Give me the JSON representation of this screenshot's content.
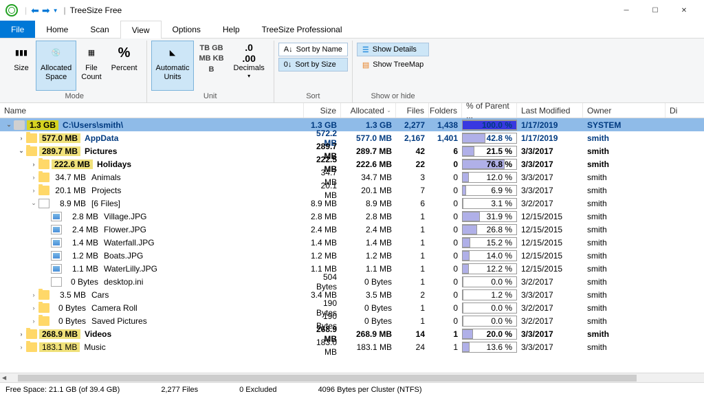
{
  "title": "TreeSize Free",
  "menus": {
    "file": "File",
    "home": "Home",
    "scan": "Scan",
    "view": "View",
    "options": "Options",
    "help": "Help",
    "pro": "TreeSize Professional"
  },
  "ribbon": {
    "mode": {
      "label": "Mode",
      "size": "Size",
      "allocated": "Allocated\nSpace",
      "filecount": "File\nCount",
      "percent": "Percent"
    },
    "unit": {
      "label": "Unit",
      "auto": "Automatic\nUnits",
      "decimals": "Decimals",
      "tb": "TB",
      "gb": "GB",
      "mb": "MB",
      "kb": "KB",
      "b": "B"
    },
    "sort": {
      "label": "Sort",
      "byname": "Sort by Name",
      "bysize": "Sort by Size"
    },
    "show": {
      "label": "Show or hide",
      "details": "Show Details",
      "treemap": "Show TreeMap"
    }
  },
  "columns": {
    "name": "Name",
    "size": "Size",
    "allocated": "Allocated",
    "files": "Files",
    "folders": "Folders",
    "pct": "% of Parent ...",
    "modified": "Last Modified",
    "owner": "Owner",
    "di": "Di"
  },
  "rows": [
    {
      "depth": 0,
      "exp": "v",
      "root": true,
      "bold": true,
      "icon": "drive",
      "boxed": true,
      "size_lbl": "1.3 GB",
      "name": "C:\\Users\\smith\\",
      "size": "1.3 GB",
      "alloc": "1.3 GB",
      "files": "2,277",
      "folders": "1,438",
      "pct": "100.0 %",
      "pctw": 100,
      "pfull": true,
      "mod": "1/17/2019",
      "owner": "SYSTEM",
      "link": true
    },
    {
      "depth": 1,
      "exp": ">",
      "bold": true,
      "icon": "folder",
      "boxed": true,
      "size_lbl": "577.0 MB",
      "name": "AppData",
      "size": "572.2 MB",
      "alloc": "577.0 MB",
      "files": "2,167",
      "folders": "1,401",
      "pct": "42.8 %",
      "pctw": 43,
      "mod": "1/17/2019",
      "owner": "smith",
      "link": true
    },
    {
      "depth": 1,
      "exp": "v",
      "bold": true,
      "icon": "folder",
      "boxed": true,
      "size_lbl": "289.7 MB",
      "name": "Pictures",
      "size": "289.7 MB",
      "alloc": "289.7 MB",
      "files": "42",
      "folders": "6",
      "pct": "21.5 %",
      "pctw": 22,
      "mod": "3/3/2017",
      "owner": "smith"
    },
    {
      "depth": 2,
      "exp": ">",
      "bold": true,
      "icon": "folder",
      "boxed": true,
      "size_lbl": "222.6 MB",
      "name": "Holidays",
      "size": "222.5 MB",
      "alloc": "222.6 MB",
      "files": "22",
      "folders": "0",
      "pct": "76.8 %",
      "pctw": 77,
      "mod": "3/3/2017",
      "owner": "smith"
    },
    {
      "depth": 2,
      "exp": ">",
      "icon": "folder",
      "size_lbl": "34.7 MB",
      "name": "Animals",
      "size": "34.7 MB",
      "alloc": "34.7 MB",
      "files": "3",
      "folders": "0",
      "pct": "12.0 %",
      "pctw": 12,
      "mod": "3/3/2017",
      "owner": "smith"
    },
    {
      "depth": 2,
      "exp": ">",
      "icon": "folder",
      "size_lbl": "20.1 MB",
      "name": "Projects",
      "size": "20.1 MB",
      "alloc": "20.1 MB",
      "files": "7",
      "folders": "0",
      "pct": "6.9 %",
      "pctw": 7,
      "mod": "3/3/2017",
      "owner": "smith"
    },
    {
      "depth": 2,
      "exp": "v",
      "icon": "file",
      "size_lbl": "8.9 MB",
      "name": "[6 Files]",
      "size": "8.9 MB",
      "alloc": "8.9 MB",
      "files": "6",
      "folders": "0",
      "pct": "3.1 %",
      "pctw": 3,
      "mod": "3/2/2017",
      "owner": "smith"
    },
    {
      "depth": 3,
      "exp": "",
      "icon": "img",
      "size_lbl": "2.8 MB",
      "name": "Village.JPG",
      "size": "2.8 MB",
      "alloc": "2.8 MB",
      "files": "1",
      "folders": "0",
      "pct": "31.9 %",
      "pctw": 32,
      "mod": "12/15/2015",
      "owner": "smith"
    },
    {
      "depth": 3,
      "exp": "",
      "icon": "img",
      "size_lbl": "2.4 MB",
      "name": "Flower.JPG",
      "size": "2.4 MB",
      "alloc": "2.4 MB",
      "files": "1",
      "folders": "0",
      "pct": "26.8 %",
      "pctw": 27,
      "mod": "12/15/2015",
      "owner": "smith"
    },
    {
      "depth": 3,
      "exp": "",
      "icon": "img",
      "size_lbl": "1.4 MB",
      "name": "Waterfall.JPG",
      "size": "1.4 MB",
      "alloc": "1.4 MB",
      "files": "1",
      "folders": "0",
      "pct": "15.2 %",
      "pctw": 15,
      "mod": "12/15/2015",
      "owner": "smith"
    },
    {
      "depth": 3,
      "exp": "",
      "icon": "img",
      "size_lbl": "1.2 MB",
      "name": "Boats.JPG",
      "size": "1.2 MB",
      "alloc": "1.2 MB",
      "files": "1",
      "folders": "0",
      "pct": "14.0 %",
      "pctw": 14,
      "mod": "12/15/2015",
      "owner": "smith"
    },
    {
      "depth": 3,
      "exp": "",
      "icon": "img",
      "size_lbl": "1.1 MB",
      "name": "WaterLilly.JPG",
      "size": "1.1 MB",
      "alloc": "1.1 MB",
      "files": "1",
      "folders": "0",
      "pct": "12.2 %",
      "pctw": 12,
      "mod": "12/15/2015",
      "owner": "smith"
    },
    {
      "depth": 3,
      "exp": "",
      "icon": "file",
      "size_lbl": "0 Bytes",
      "name": "desktop.ini",
      "size": "504 Bytes",
      "alloc": "0 Bytes",
      "files": "1",
      "folders": "0",
      "pct": "0.0 %",
      "pctw": 0,
      "mod": "3/2/2017",
      "owner": "smith"
    },
    {
      "depth": 2,
      "exp": ">",
      "icon": "folder",
      "size_lbl": "3.5 MB",
      "name": "Cars",
      "size": "3.4 MB",
      "alloc": "3.5 MB",
      "files": "2",
      "folders": "0",
      "pct": "1.2 %",
      "pctw": 1,
      "mod": "3/3/2017",
      "owner": "smith"
    },
    {
      "depth": 2,
      "exp": ">",
      "icon": "folder",
      "size_lbl": "0 Bytes",
      "name": "Camera Roll",
      "size": "190 Bytes",
      "alloc": "0 Bytes",
      "files": "1",
      "folders": "0",
      "pct": "0.0 %",
      "pctw": 0,
      "mod": "3/2/2017",
      "owner": "smith"
    },
    {
      "depth": 2,
      "exp": ">",
      "icon": "folder",
      "size_lbl": "0 Bytes",
      "name": "Saved Pictures",
      "size": "190 Bytes",
      "alloc": "0 Bytes",
      "files": "1",
      "folders": "0",
      "pct": "0.0 %",
      "pctw": 0,
      "mod": "3/2/2017",
      "owner": "smith"
    },
    {
      "depth": 1,
      "exp": ">",
      "bold": true,
      "icon": "folder",
      "boxed": true,
      "size_lbl": "268.9 MB",
      "name": "Videos",
      "size": "268.9 MB",
      "alloc": "268.9 MB",
      "files": "14",
      "folders": "1",
      "pct": "20.0 %",
      "pctw": 20,
      "mod": "3/3/2017",
      "owner": "smith"
    },
    {
      "depth": 1,
      "exp": ">",
      "icon": "folder",
      "boxed": true,
      "size_lbl": "183.1 MB",
      "name": "Music",
      "size": "183.0 MB",
      "alloc": "183.1 MB",
      "files": "24",
      "folders": "1",
      "pct": "13.6 %",
      "pctw": 14,
      "mod": "3/3/2017",
      "owner": "smith"
    }
  ],
  "status": {
    "free": "Free Space: 21.1 GB  (of 39.4 GB)",
    "files": "2,277 Files",
    "excluded": "0 Excluded",
    "cluster": "4096  Bytes per Cluster (NTFS)"
  }
}
